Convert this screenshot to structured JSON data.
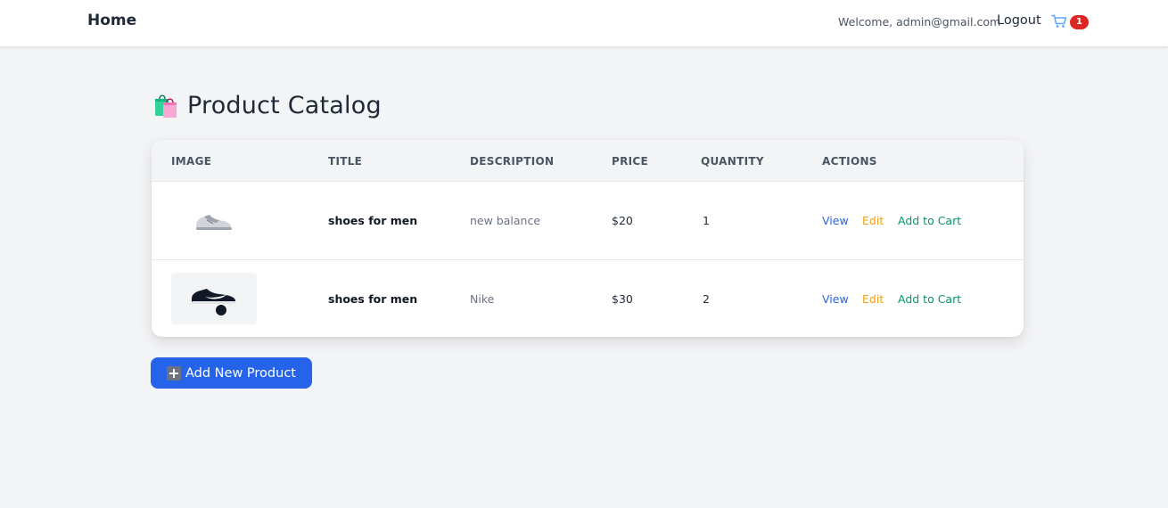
{
  "nav": {
    "home": "Home",
    "welcome": "Welcome, admin@gmail.com",
    "logout": "Logout",
    "cart_count": "1"
  },
  "page": {
    "title": "Product Catalog",
    "title_icon": "shopping-bags-icon"
  },
  "table": {
    "headers": [
      "IMAGE",
      "TITLE",
      "DESCRIPTION",
      "PRICE",
      "QUANTITY",
      "ACTIONS"
    ],
    "rows": [
      {
        "image": "grey-sneaker-image",
        "title": "shoes for men",
        "description": "new balance",
        "price": "$20",
        "quantity": "1",
        "actions": [
          "View",
          "Edit",
          "Add to Cart"
        ]
      },
      {
        "image": "black-sneaker-image",
        "title": "shoes for men",
        "description": "Nike",
        "price": "$30",
        "quantity": "2",
        "actions": [
          "View",
          "Edit",
          "Add to Cart"
        ]
      }
    ]
  },
  "add_button": {
    "label": "Add New Product",
    "icon": "plus-icon"
  },
  "colors": {
    "primary": "#2563eb",
    "view": "#2563eb",
    "edit": "#f59e0b",
    "add_to_cart": "#059669",
    "badge": "#dc2626",
    "background": "#f3f4f6"
  }
}
